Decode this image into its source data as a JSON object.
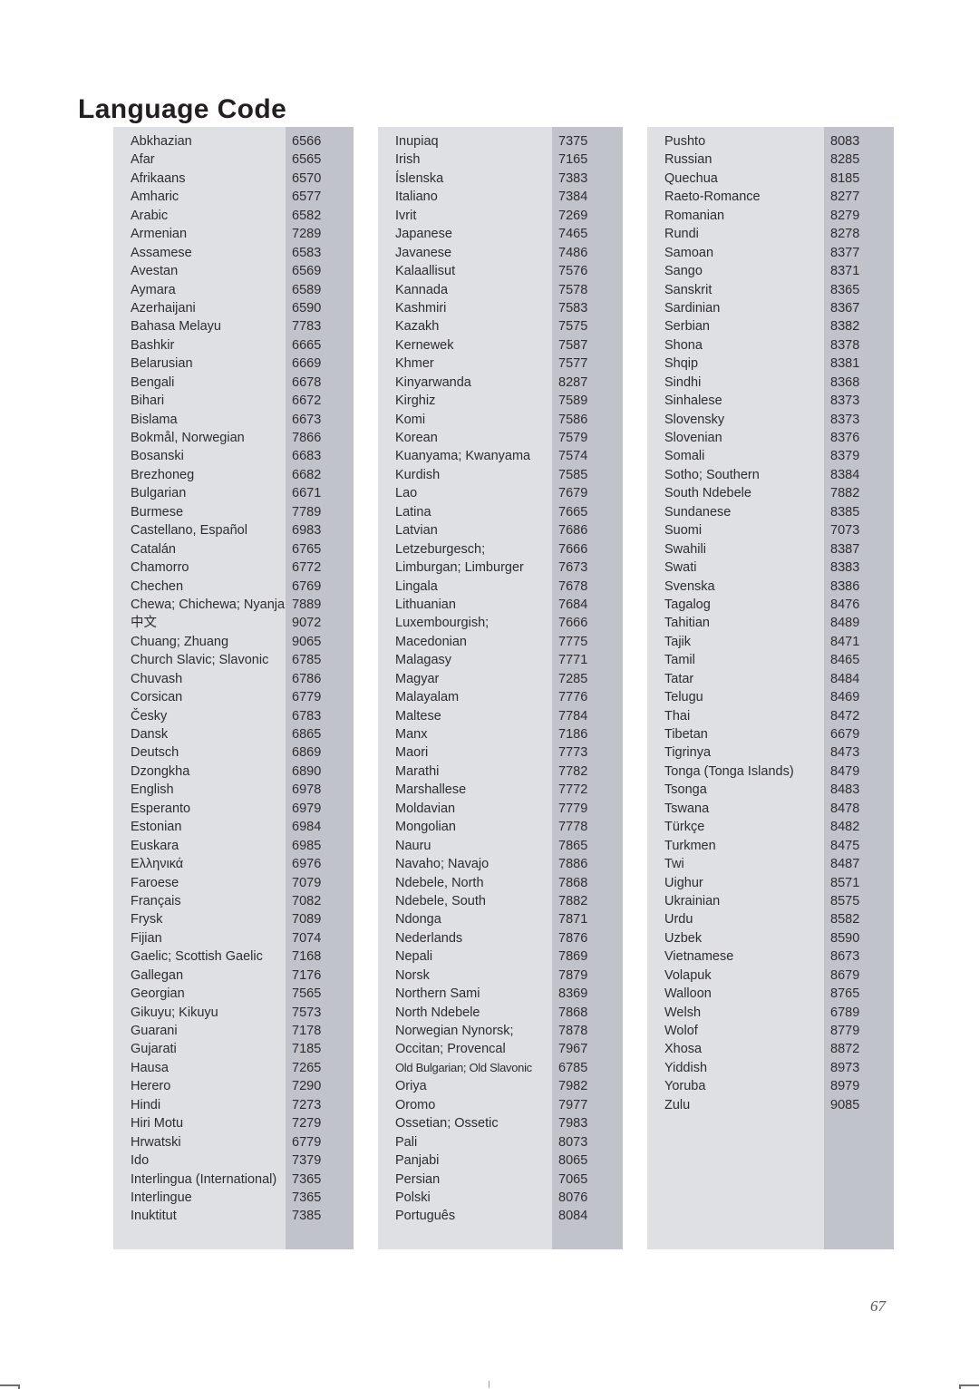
{
  "document": {
    "title": "Language Code",
    "page_number": "67"
  },
  "colors": {
    "panel_name_bg": "#dfe0e4",
    "panel_code_bg": "#c0c3ca",
    "text": "#2e2c2e",
    "title": "#231f20",
    "page_number": "#58585a",
    "background": "#ffffff"
  },
  "columns": [
    {
      "id": "column-1",
      "rows": [
        {
          "language": "Abkhazian",
          "code": "6566"
        },
        {
          "language": "Afar",
          "code": "6565"
        },
        {
          "language": "Afrikaans",
          "code": "6570"
        },
        {
          "language": "Amharic",
          "code": "6577"
        },
        {
          "language": "Arabic",
          "code": "6582"
        },
        {
          "language": "Armenian",
          "code": "7289"
        },
        {
          "language": "Assamese",
          "code": "6583"
        },
        {
          "language": "Avestan",
          "code": "6569"
        },
        {
          "language": "Aymara",
          "code": "6589"
        },
        {
          "language": "Azerhaijani",
          "code": "6590"
        },
        {
          "language": "Bahasa Melayu",
          "code": "7783"
        },
        {
          "language": "Bashkir",
          "code": "6665"
        },
        {
          "language": "Belarusian",
          "code": "6669"
        },
        {
          "language": "Bengali",
          "code": "6678"
        },
        {
          "language": "Bihari",
          "code": "6672"
        },
        {
          "language": "Bislama",
          "code": "6673"
        },
        {
          "language": "Bokmål, Norwegian",
          "code": "7866"
        },
        {
          "language": "Bosanski",
          "code": "6683"
        },
        {
          "language": "Brezhoneg",
          "code": "6682"
        },
        {
          "language": "Bulgarian",
          "code": "6671"
        },
        {
          "language": "Burmese",
          "code": "7789"
        },
        {
          "language": "Castellano, Español",
          "code": "6983"
        },
        {
          "language": "Catalán",
          "code": "6765"
        },
        {
          "language": "Chamorro",
          "code": "6772"
        },
        {
          "language": "Chechen",
          "code": "6769"
        },
        {
          "language": "Chewa; Chichewa; Nyanja",
          "code": "7889"
        },
        {
          "language": "中文",
          "code": "9072",
          "cjk": true
        },
        {
          "language": "Chuang; Zhuang",
          "code": "9065"
        },
        {
          "language": "Church Slavic; Slavonic",
          "code": "6785"
        },
        {
          "language": "Chuvash",
          "code": "6786"
        },
        {
          "language": "Corsican",
          "code": "6779"
        },
        {
          "language": "Česky",
          "code": "6783"
        },
        {
          "language": "Dansk",
          "code": "6865"
        },
        {
          "language": "Deutsch",
          "code": "6869"
        },
        {
          "language": "Dzongkha",
          "code": "6890"
        },
        {
          "language": "English",
          "code": "6978"
        },
        {
          "language": "Esperanto",
          "code": "6979"
        },
        {
          "language": "Estonian",
          "code": "6984"
        },
        {
          "language": "Euskara",
          "code": "6985"
        },
        {
          "language": "Ελληνικά",
          "code": "6976"
        },
        {
          "language": "Faroese",
          "code": "7079"
        },
        {
          "language": "Français",
          "code": "7082"
        },
        {
          "language": "Frysk",
          "code": "7089"
        },
        {
          "language": "Fijian",
          "code": "7074"
        },
        {
          "language": "Gaelic; Scottish Gaelic",
          "code": "7168"
        },
        {
          "language": "Gallegan",
          "code": "7176"
        },
        {
          "language": "Georgian",
          "code": "7565"
        },
        {
          "language": "Gikuyu; Kikuyu",
          "code": "7573"
        },
        {
          "language": "Guarani",
          "code": "7178"
        },
        {
          "language": "Gujarati",
          "code": "7185"
        },
        {
          "language": "Hausa",
          "code": "7265"
        },
        {
          "language": "Herero",
          "code": "7290"
        },
        {
          "language": "Hindi",
          "code": "7273"
        },
        {
          "language": "Hiri Motu",
          "code": "7279"
        },
        {
          "language": "Hrwatski",
          "code": "6779"
        },
        {
          "language": "Ido",
          "code": "7379"
        },
        {
          "language": "Interlingua (International)",
          "code": "7365"
        },
        {
          "language": "Interlingue",
          "code": "7365"
        },
        {
          "language": "Inuktitut",
          "code": "7385"
        }
      ]
    },
    {
      "id": "column-2",
      "rows": [
        {
          "language": "Inupiaq",
          "code": "7375"
        },
        {
          "language": "Irish",
          "code": "7165"
        },
        {
          "language": "Íslenska",
          "code": "7383"
        },
        {
          "language": "Italiano",
          "code": "7384"
        },
        {
          "language": "Ivrit",
          "code": "7269"
        },
        {
          "language": "Japanese",
          "code": "7465"
        },
        {
          "language": "Javanese",
          "code": "7486"
        },
        {
          "language": "Kalaallisut",
          "code": "7576"
        },
        {
          "language": "Kannada",
          "code": "7578"
        },
        {
          "language": "Kashmiri",
          "code": "7583"
        },
        {
          "language": "Kazakh",
          "code": "7575"
        },
        {
          "language": "Kernewek",
          "code": "7587"
        },
        {
          "language": "Khmer",
          "code": "7577"
        },
        {
          "language": "Kinyarwanda",
          "code": "8287"
        },
        {
          "language": "Kirghiz",
          "code": "7589"
        },
        {
          "language": "Komi",
          "code": "7586"
        },
        {
          "language": "Korean",
          "code": "7579"
        },
        {
          "language": "Kuanyama; Kwanyama",
          "code": "7574"
        },
        {
          "language": "Kurdish",
          "code": "7585"
        },
        {
          "language": "Lao",
          "code": "7679"
        },
        {
          "language": "Latina",
          "code": "7665"
        },
        {
          "language": "Latvian",
          "code": "7686"
        },
        {
          "language": "Letzeburgesch;",
          "code": "7666"
        },
        {
          "language": "Limburgan; Limburger",
          "code": "7673"
        },
        {
          "language": "Lingala",
          "code": "7678"
        },
        {
          "language": "Lithuanian",
          "code": "7684"
        },
        {
          "language": "Luxembourgish;",
          "code": "7666"
        },
        {
          "language": "Macedonian",
          "code": "7775"
        },
        {
          "language": "Malagasy",
          "code": "7771"
        },
        {
          "language": "Magyar",
          "code": "7285"
        },
        {
          "language": "Malayalam",
          "code": "7776"
        },
        {
          "language": "Maltese",
          "code": "7784"
        },
        {
          "language": "Manx",
          "code": "7186"
        },
        {
          "language": "Maori",
          "code": "7773"
        },
        {
          "language": "Marathi",
          "code": "7782"
        },
        {
          "language": "Marshallese",
          "code": "7772"
        },
        {
          "language": "Moldavian",
          "code": "7779"
        },
        {
          "language": "Mongolian",
          "code": "7778"
        },
        {
          "language": "Nauru",
          "code": "7865"
        },
        {
          "language": "Navaho; Navajo",
          "code": "7886"
        },
        {
          "language": "Ndebele, North",
          "code": "7868"
        },
        {
          "language": "Ndebele, South",
          "code": "7882"
        },
        {
          "language": "Ndonga",
          "code": "7871"
        },
        {
          "language": "Nederlands",
          "code": "7876"
        },
        {
          "language": "Nepali",
          "code": "7869"
        },
        {
          "language": "Norsk",
          "code": "7879"
        },
        {
          "language": "Northern Sami",
          "code": "8369"
        },
        {
          "language": "North Ndebele",
          "code": "7868"
        },
        {
          "language": "Norwegian Nynorsk;",
          "code": "7878"
        },
        {
          "language": "Occitan; Provencal",
          "code": "7967"
        },
        {
          "language": "Old Bulgarian; Old Slavonic",
          "code": "6785",
          "condensed": true
        },
        {
          "language": "Oriya",
          "code": "7982"
        },
        {
          "language": "Oromo",
          "code": "7977"
        },
        {
          "language": "Ossetian; Ossetic",
          "code": "7983"
        },
        {
          "language": "Pali",
          "code": "8073"
        },
        {
          "language": "Panjabi",
          "code": "8065"
        },
        {
          "language": "Persian",
          "code": "7065"
        },
        {
          "language": "Polski",
          "code": "8076"
        },
        {
          "language": "Português",
          "code": "8084"
        }
      ]
    },
    {
      "id": "column-3",
      "rows": [
        {
          "language": "Pushto",
          "code": "8083"
        },
        {
          "language": "Russian",
          "code": "8285"
        },
        {
          "language": "Quechua",
          "code": "8185"
        },
        {
          "language": "Raeto-Romance",
          "code": "8277"
        },
        {
          "language": "Romanian",
          "code": "8279"
        },
        {
          "language": "Rundi",
          "code": "8278"
        },
        {
          "language": "Samoan",
          "code": "8377"
        },
        {
          "language": "Sango",
          "code": "8371"
        },
        {
          "language": "Sanskrit",
          "code": "8365"
        },
        {
          "language": "Sardinian",
          "code": "8367"
        },
        {
          "language": "Serbian",
          "code": "8382"
        },
        {
          "language": "Shona",
          "code": "8378"
        },
        {
          "language": "Shqip",
          "code": "8381"
        },
        {
          "language": "Sindhi",
          "code": "8368"
        },
        {
          "language": "Sinhalese",
          "code": "8373"
        },
        {
          "language": "Slovensky",
          "code": "8373"
        },
        {
          "language": "Slovenian",
          "code": "8376"
        },
        {
          "language": "Somali",
          "code": "8379"
        },
        {
          "language": "Sotho; Southern",
          "code": "8384"
        },
        {
          "language": "South Ndebele",
          "code": "7882"
        },
        {
          "language": "Sundanese",
          "code": "8385"
        },
        {
          "language": "Suomi",
          "code": "7073"
        },
        {
          "language": "Swahili",
          "code": "8387"
        },
        {
          "language": "Swati",
          "code": "8383"
        },
        {
          "language": "Svenska",
          "code": "8386"
        },
        {
          "language": "Tagalog",
          "code": "8476"
        },
        {
          "language": "Tahitian",
          "code": "8489"
        },
        {
          "language": "Tajik",
          "code": "8471"
        },
        {
          "language": "Tamil",
          "code": "8465"
        },
        {
          "language": "Tatar",
          "code": "8484"
        },
        {
          "language": "Telugu",
          "code": "8469"
        },
        {
          "language": "Thai",
          "code": "8472"
        },
        {
          "language": "Tibetan",
          "code": "6679"
        },
        {
          "language": "Tigrinya",
          "code": "8473"
        },
        {
          "language": "Tonga (Tonga Islands)",
          "code": "8479"
        },
        {
          "language": "Tsonga",
          "code": "8483"
        },
        {
          "language": "Tswana",
          "code": "8478"
        },
        {
          "language": "Türkçe",
          "code": "8482"
        },
        {
          "language": "Turkmen",
          "code": "8475"
        },
        {
          "language": "Twi",
          "code": "8487"
        },
        {
          "language": "Uighur",
          "code": "8571"
        },
        {
          "language": "Ukrainian",
          "code": "8575"
        },
        {
          "language": "Urdu",
          "code": "8582"
        },
        {
          "language": "Uzbek",
          "code": "8590"
        },
        {
          "language": "Vietnamese",
          "code": "8673"
        },
        {
          "language": "Volapuk",
          "code": "8679"
        },
        {
          "language": "Walloon",
          "code": "8765"
        },
        {
          "language": "Welsh",
          "code": "6789"
        },
        {
          "language": "Wolof",
          "code": "8779"
        },
        {
          "language": "Xhosa",
          "code": "8872"
        },
        {
          "language": "Yiddish",
          "code": "8973"
        },
        {
          "language": "Yoruba",
          "code": "8979"
        },
        {
          "language": "Zulu",
          "code": "9085"
        }
      ]
    }
  ]
}
